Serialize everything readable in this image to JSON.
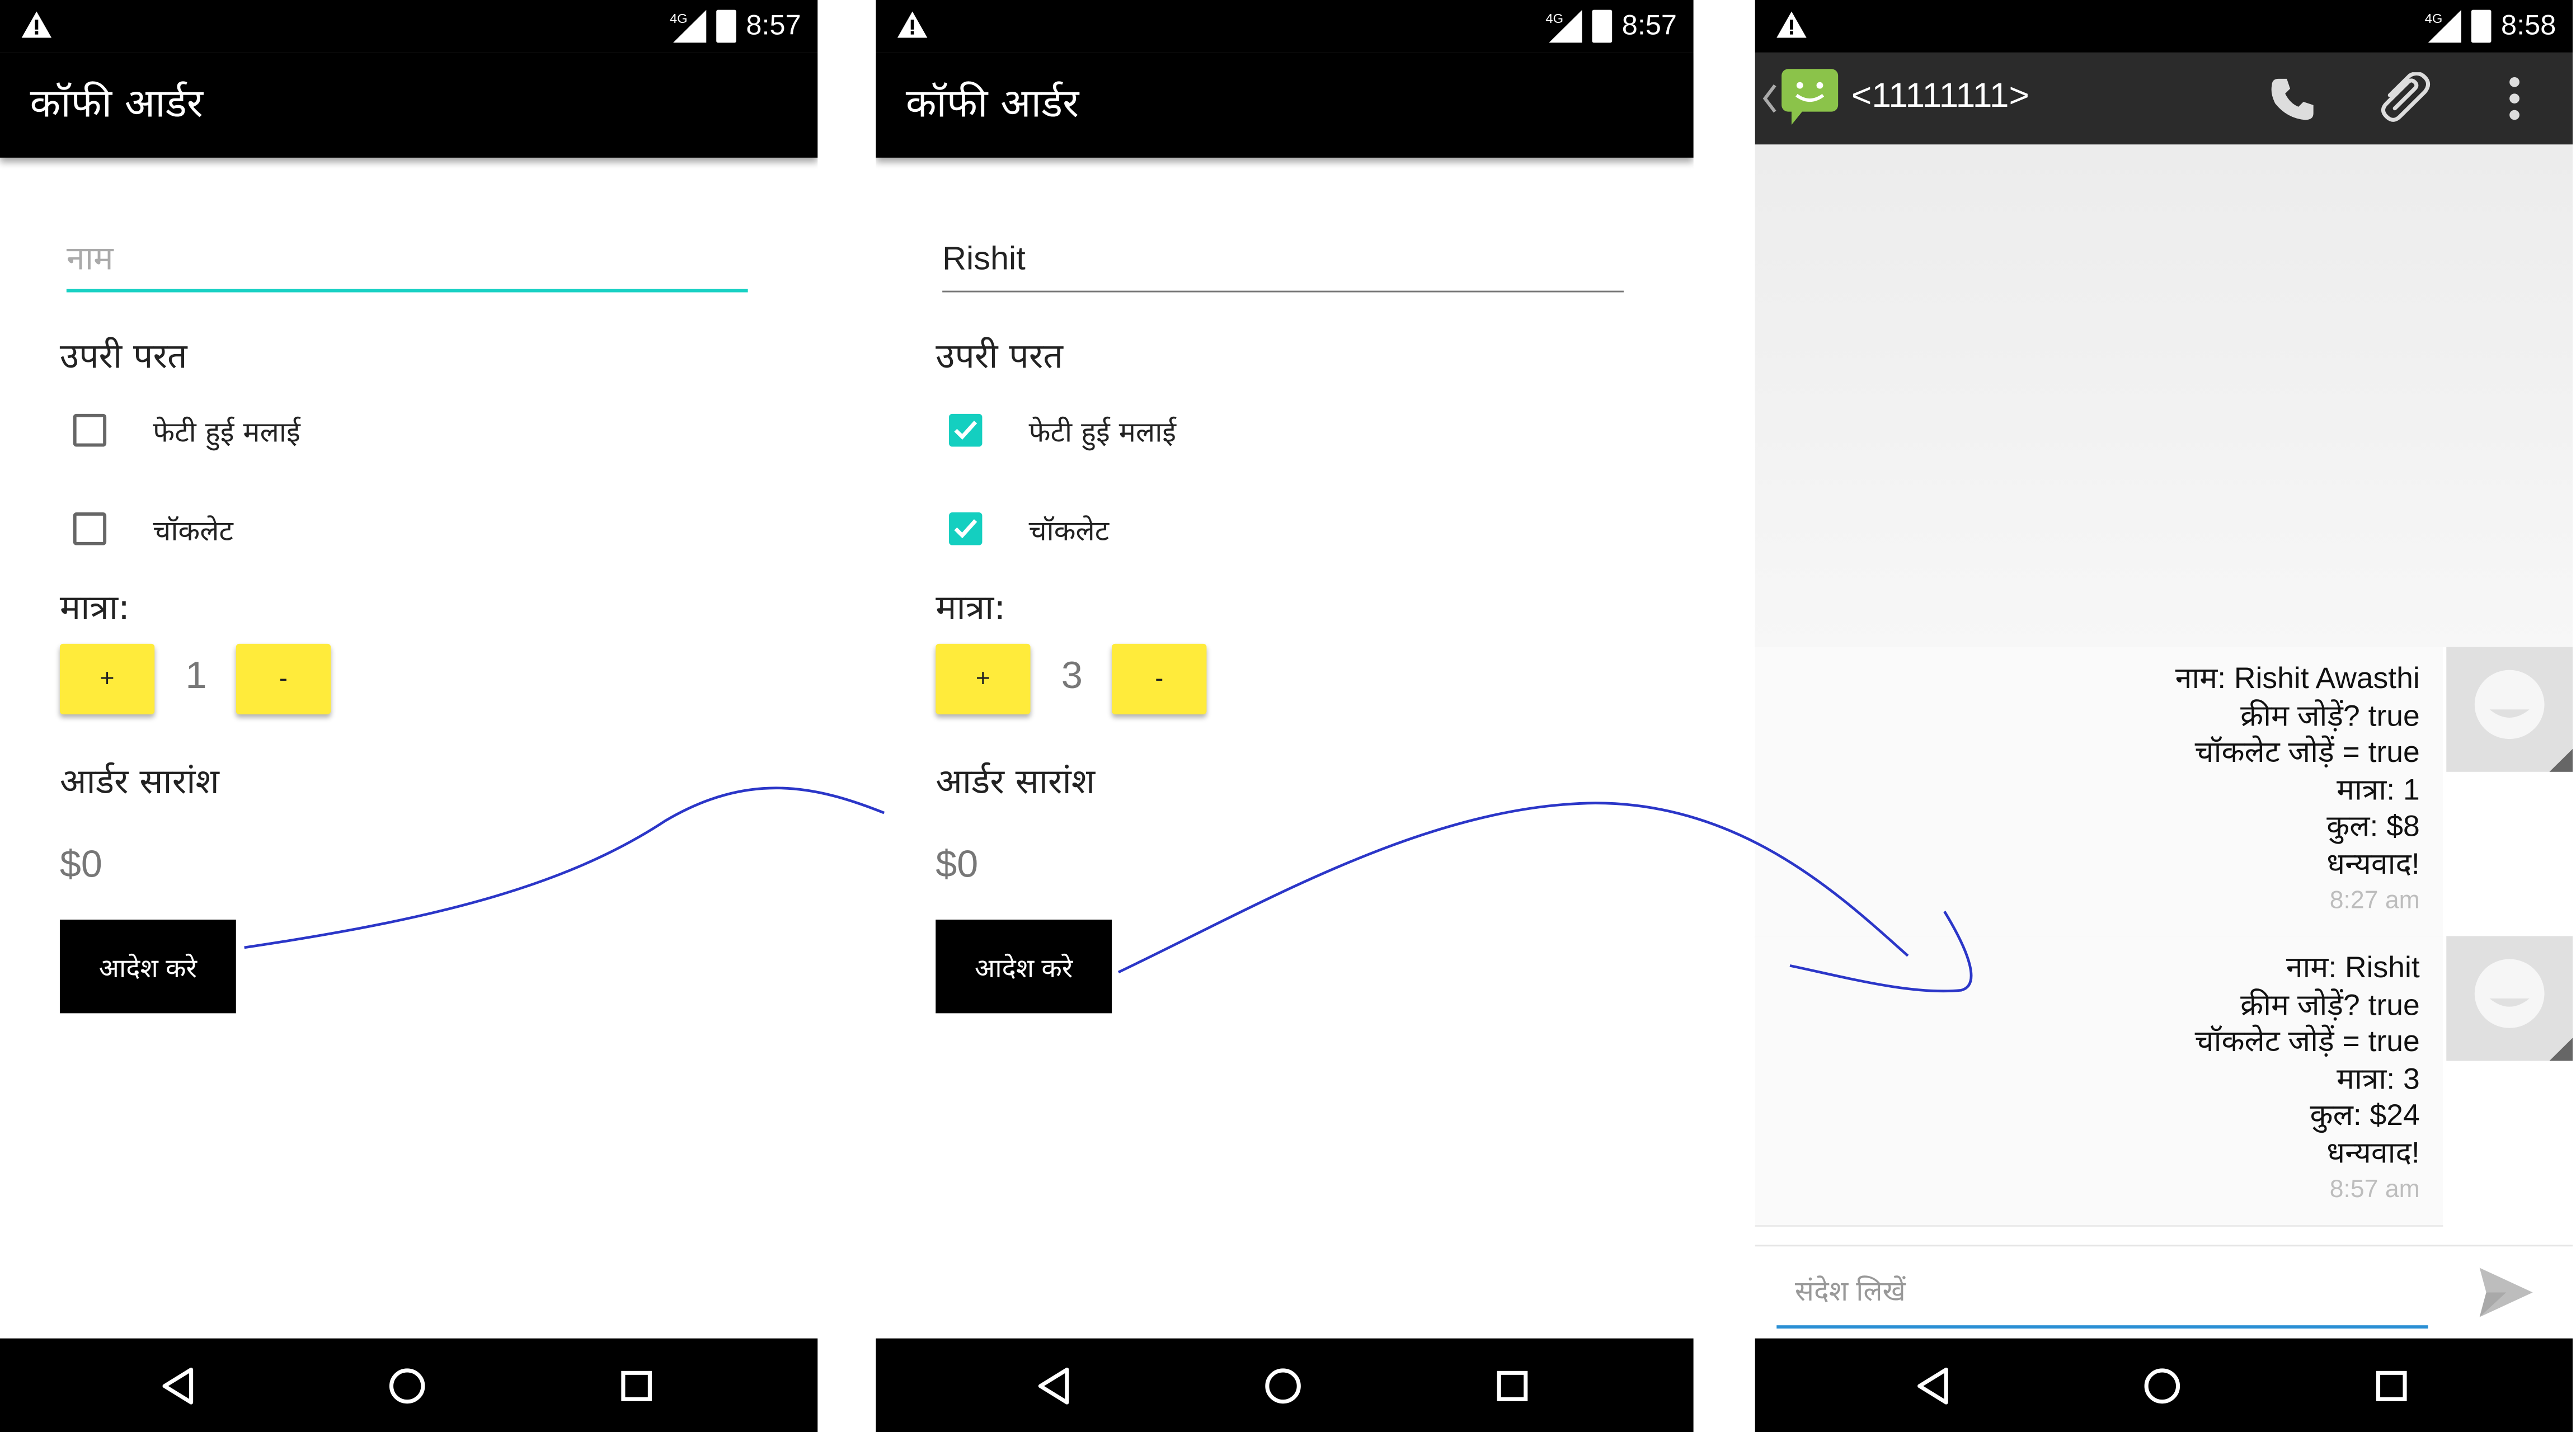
{
  "screen1": {
    "status": {
      "time": "8:57",
      "network": "4G"
    },
    "app_title": "कॉफी आर्डर",
    "name_field": {
      "value": "",
      "placeholder": "नाम"
    },
    "toppings_heading": "उपरी परत",
    "toppings": [
      {
        "label": "फेटी हुई मलाई",
        "checked": false
      },
      {
        "label": "चॉकलेट",
        "checked": false
      }
    ],
    "quantity_label": "मात्रा:",
    "plus_label": "+",
    "minus_label": "-",
    "quantity": "1",
    "summary_heading": "आर्डर सारांश",
    "price": "$0",
    "order_button": "आदेश करे"
  },
  "screen2": {
    "status": {
      "time": "8:57",
      "network": "4G"
    },
    "app_title": "कॉफी आर्डर",
    "name_field": {
      "value": "Rishit",
      "placeholder": "नाम"
    },
    "toppings_heading": "उपरी परत",
    "toppings": [
      {
        "label": "फेटी हुई मलाई",
        "checked": true
      },
      {
        "label": "चॉकलेट",
        "checked": true
      }
    ],
    "quantity_label": "मात्रा:",
    "plus_label": "+",
    "minus_label": "-",
    "quantity": "3",
    "summary_heading": "आर्डर सारांश",
    "price": "$0",
    "order_button": "आदेश करे"
  },
  "screen3": {
    "status": {
      "time": "8:58",
      "network": "4G"
    },
    "contact": "<11111111>",
    "messages": [
      {
        "lines": [
          "नाम: Rishit Awasthi",
          "क्रीम जोड़ें? true",
          "चॉकलेट जोड़ें = true",
          "मात्रा: 1",
          "कुल: $8",
          "धन्यवाद!"
        ],
        "time": "8:27 am"
      },
      {
        "lines": [
          "नाम: Rishit",
          "क्रीम जोड़ें? true",
          "चॉकलेट जोड़ें = true",
          "मात्रा: 3",
          "कुल: $24",
          "धन्यवाद!"
        ],
        "time": "8:57 am"
      }
    ],
    "compose_placeholder": "संदेश लिखें"
  },
  "colors": {
    "accent": "#19d1c4",
    "button_yellow": "#ffeb3b",
    "bar_black": "#000000",
    "arrow_blue": "#2b36c8",
    "compose_line": "#2a8fd4"
  }
}
